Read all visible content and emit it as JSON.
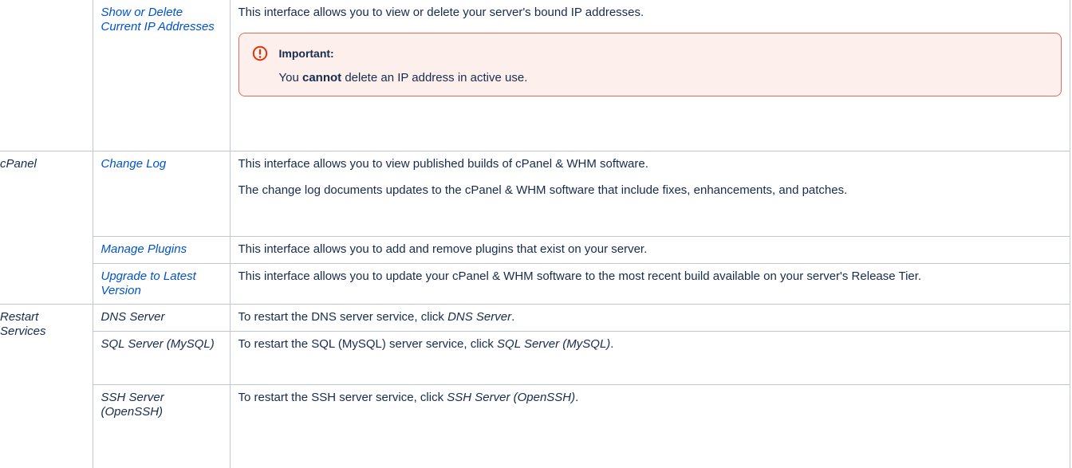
{
  "rows": {
    "ip": {
      "link": "Show or Delete Current IP Addresses",
      "description": "This interface allows you to view or delete your server's bound IP addresses.",
      "callout": {
        "title": "Important:",
        "body_before": "You ",
        "body_bold": "cannot",
        "body_after": " delete an IP address in active use."
      }
    },
    "cpanel": {
      "category": "cPanel",
      "items": [
        {
          "link": "Change Log",
          "description": "This interface allows you to view published builds of cPanel & WHM software.",
          "description2": "The change log documents updates to the cPanel & WHM software that include fixes, enhancements, and patches."
        },
        {
          "link": "Manage Plugins",
          "description": "This interface allows you to add and remove plugins that exist on your server."
        },
        {
          "link": "Upgrade to Latest Version",
          "description": "This interface allows you to update your cPanel & WHM software to the most recent build available on your server's Release Tier."
        }
      ]
    },
    "restart": {
      "category": "Restart Services",
      "items": [
        {
          "name": "DNS Server",
          "description": "To restart the DNS server service, click ",
          "emphasis": "DNS Server",
          "suffix": "."
        },
        {
          "name": "SQL Server (MySQL)",
          "description": "To restart the SQL (MySQL) server service, click ",
          "emphasis": "SQL Server (MySQL)",
          "suffix": "."
        },
        {
          "name": "SSH Server (OpenSSH)",
          "description": "To restart the SSH server service, click ",
          "emphasis": "SSH Server (OpenSSH)",
          "suffix": "."
        }
      ]
    }
  },
  "colors": {
    "link": "#0052cc",
    "text": "#172b4d",
    "border": "#c1c7d0",
    "callout_border": "#e26a57",
    "callout_bg": "#fcefec"
  },
  "icons": {
    "callout": "warning-circle-icon"
  }
}
